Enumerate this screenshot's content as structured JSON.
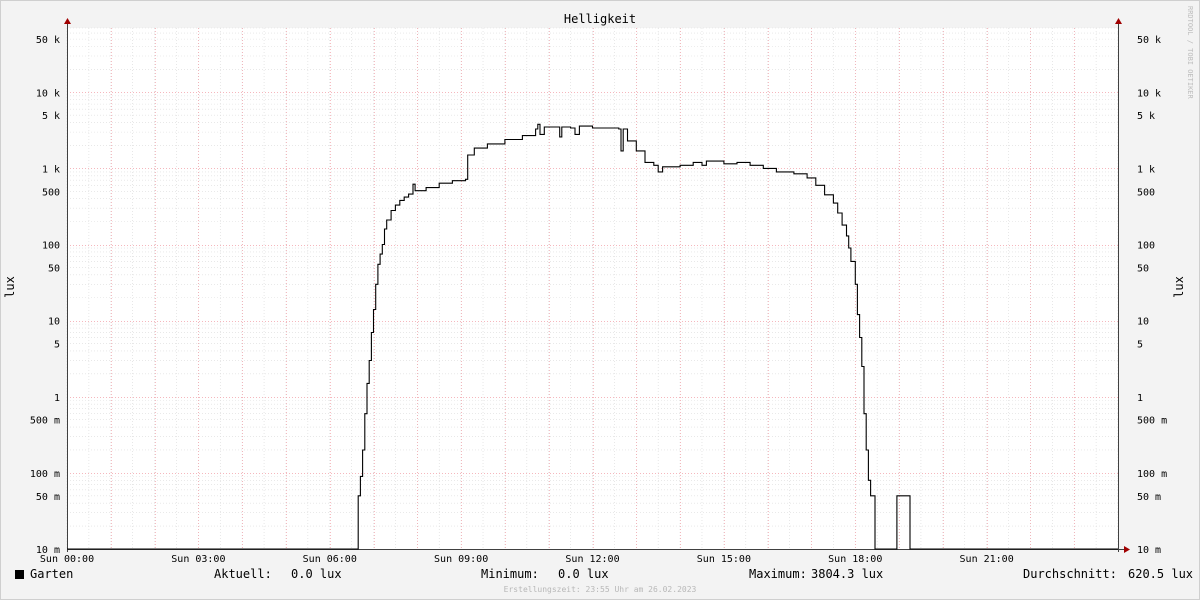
{
  "chart_data": {
    "type": "line",
    "title": "Helligkeit",
    "ylabel": "lux",
    "yscale": "log",
    "ylim": [
      0.01,
      70000
    ],
    "xlim": [
      0,
      24
    ],
    "watermark": "RRDTOOL / TOBI OETIKER",
    "yticks": [
      {
        "v": 50000,
        "label": "50 k"
      },
      {
        "v": 10000,
        "label": "10 k"
      },
      {
        "v": 5000,
        "label": "5 k"
      },
      {
        "v": 1000,
        "label": "1 k"
      },
      {
        "v": 500,
        "label": "500"
      },
      {
        "v": 100,
        "label": "100"
      },
      {
        "v": 50,
        "label": "50"
      },
      {
        "v": 10,
        "label": "10"
      },
      {
        "v": 5,
        "label": "5"
      },
      {
        "v": 1,
        "label": "1"
      },
      {
        "v": 0.5,
        "label": "500 m"
      },
      {
        "v": 0.1,
        "label": "100 m"
      },
      {
        "v": 0.05,
        "label": "50 m"
      },
      {
        "v": 0.01,
        "label": "10 m"
      }
    ],
    "xticks": [
      {
        "v": 0,
        "label": "Sun 00:00"
      },
      {
        "v": 3,
        "label": "Sun 03:00"
      },
      {
        "v": 6,
        "label": "Sun 06:00"
      },
      {
        "v": 9,
        "label": "Sun 09:00"
      },
      {
        "v": 12,
        "label": "Sun 12:00"
      },
      {
        "v": 15,
        "label": "Sun 15:00"
      },
      {
        "v": 18,
        "label": "Sun 18:00"
      },
      {
        "v": 21,
        "label": "Sun 21:00"
      }
    ],
    "series": [
      {
        "name": "Garten",
        "color": "#000000",
        "points": [
          [
            0,
            0.01
          ],
          [
            6.6,
            0.01
          ],
          [
            6.65,
            0.05
          ],
          [
            6.7,
            0.09
          ],
          [
            6.75,
            0.2
          ],
          [
            6.8,
            0.6
          ],
          [
            6.85,
            1.5
          ],
          [
            6.9,
            3
          ],
          [
            6.95,
            7
          ],
          [
            7.0,
            14
          ],
          [
            7.05,
            30
          ],
          [
            7.1,
            55
          ],
          [
            7.15,
            75
          ],
          [
            7.2,
            100
          ],
          [
            7.25,
            160
          ],
          [
            7.3,
            210
          ],
          [
            7.4,
            280
          ],
          [
            7.5,
            330
          ],
          [
            7.6,
            380
          ],
          [
            7.7,
            420
          ],
          [
            7.8,
            460
          ],
          [
            7.9,
            620
          ],
          [
            7.95,
            510
          ],
          [
            8.2,
            560
          ],
          [
            8.5,
            640
          ],
          [
            8.8,
            690
          ],
          [
            9.1,
            720
          ],
          [
            9.15,
            1500
          ],
          [
            9.3,
            1850
          ],
          [
            9.6,
            2100
          ],
          [
            10.0,
            2400
          ],
          [
            10.4,
            2700
          ],
          [
            10.7,
            3300
          ],
          [
            10.75,
            3800
          ],
          [
            10.8,
            2800
          ],
          [
            10.9,
            3500
          ],
          [
            11.2,
            3500
          ],
          [
            11.25,
            2600
          ],
          [
            11.3,
            3500
          ],
          [
            11.5,
            3400
          ],
          [
            11.6,
            2800
          ],
          [
            11.7,
            3600
          ],
          [
            12.0,
            3400
          ],
          [
            12.4,
            3400
          ],
          [
            12.6,
            3300
          ],
          [
            12.65,
            1700
          ],
          [
            12.7,
            3300
          ],
          [
            12.8,
            2300
          ],
          [
            13.0,
            1700
          ],
          [
            13.2,
            1200
          ],
          [
            13.4,
            1100
          ],
          [
            13.5,
            900
          ],
          [
            13.6,
            1050
          ],
          [
            14.0,
            1100
          ],
          [
            14.3,
            1200
          ],
          [
            14.5,
            1100
          ],
          [
            14.6,
            1250
          ],
          [
            15.0,
            1150
          ],
          [
            15.3,
            1200
          ],
          [
            15.6,
            1100
          ],
          [
            15.9,
            1000
          ],
          [
            16.2,
            900
          ],
          [
            16.6,
            850
          ],
          [
            16.9,
            750
          ],
          [
            17.1,
            600
          ],
          [
            17.3,
            450
          ],
          [
            17.5,
            350
          ],
          [
            17.6,
            260
          ],
          [
            17.7,
            180
          ],
          [
            17.8,
            130
          ],
          [
            17.85,
            90
          ],
          [
            17.9,
            60
          ],
          [
            18.0,
            30
          ],
          [
            18.05,
            12
          ],
          [
            18.1,
            6
          ],
          [
            18.15,
            2.5
          ],
          [
            18.2,
            0.6
          ],
          [
            18.25,
            0.2
          ],
          [
            18.3,
            0.08
          ],
          [
            18.35,
            0.05
          ],
          [
            18.4,
            0.05
          ],
          [
            18.45,
            0.01
          ],
          [
            18.9,
            0.01
          ],
          [
            18.95,
            0.05
          ],
          [
            19.2,
            0.05
          ],
          [
            19.25,
            0.01
          ],
          [
            24,
            0.01
          ]
        ]
      }
    ]
  },
  "legend": {
    "series_name": "Garten",
    "current_label": "Aktuell:",
    "current_value": "0.0 lux",
    "minimum_label": "Minimum:",
    "minimum_value": "0.0 lux",
    "maximum_label": "Maximum:",
    "maximum_value": "3804.3 lux",
    "average_label": "Durchschnitt:",
    "average_value": "620.5 lux"
  },
  "footer": "Erstellungszeit: 23:55 Uhr am 26.02.2023"
}
